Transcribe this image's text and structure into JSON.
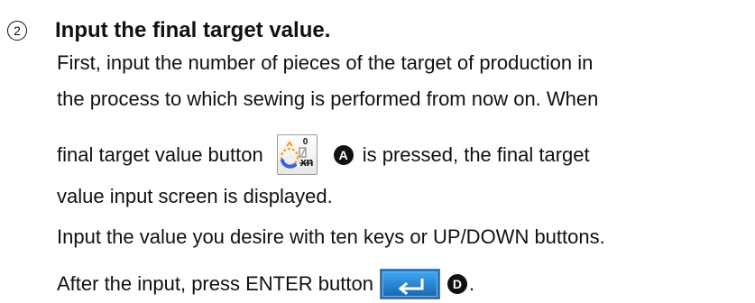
{
  "step": {
    "number": "2",
    "title": "Input the final target value."
  },
  "lines": {
    "line1": "First, input the number of pieces of the target of production in",
    "line2": "the process to which sewing is performed from now on. When",
    "line3_before_button": "final target value button",
    "line3_after_marker": "is pressed, the final target",
    "line4": "value input screen is displayed.",
    "line5": "Input the value you desire with ten keys or UP/DOWN buttons.",
    "line6_before_button": "After the input, press ENTER button",
    "line6_after_marker": "."
  },
  "buttons": {
    "final_target": {
      "top_label": "0",
      "bottom_label": "xn",
      "marker": "A",
      "icon": "target-progress-icon"
    },
    "enter": {
      "marker": "D",
      "icon": "enter-arrow-icon"
    }
  },
  "colors": {
    "text": "#111111",
    "enter_blue": "#2c6fad",
    "icon_orange": "#ff9d00",
    "icon_blue": "#3367d6"
  }
}
